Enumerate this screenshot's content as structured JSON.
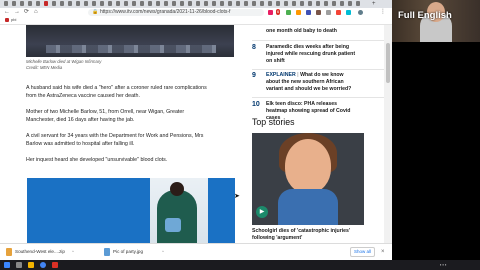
{
  "browser": {
    "url": "https://www.itv.com/news/granada/2021-11-26/blood-clots-f",
    "bookmark_label": "pbi",
    "badge": "6"
  },
  "article": {
    "caption_line1": "Michelle Barlow died at Wigan Infirmary",
    "caption_line2": "Credit: MEN Media",
    "paragraphs": [
      [
        "A husband said his wife died a \"hero\" after a coroner ruled rare complications",
        "from the AstraZeneca vaccine caused her death."
      ],
      [
        "Mother of two Michelle Barlow, 51, from Orrell, near Wigan, Greater",
        "Manchester, died 16 days after having the jab."
      ],
      [
        "A civil servant for 34 years with the Department for Work and Pensions, Mrs",
        "Barlow was admitted to hospital after falling ill."
      ],
      [
        "Her inquest heard she developed \"unsurvivable\" blood clots."
      ]
    ]
  },
  "most_read": [
    {
      "num": "",
      "tag": "",
      "line1": "one month old baby to death",
      "line2": ""
    },
    {
      "num": "8",
      "tag": "",
      "line1": "Paramedic dies weeks after being",
      "line2": "injured while rescuing drunk patient",
      "line3": "on shift"
    },
    {
      "num": "9",
      "tag": "Explainer",
      "line1": "What do we know",
      "line2": "about the new southern African",
      "line3": "variant and should we be worried?"
    },
    {
      "num": "10",
      "tag": "",
      "line1": "Elk teen disco: PHA releases",
      "line2": "heatmap showing spread of Covid",
      "line3": "cases"
    }
  ],
  "top_stories": {
    "heading": "Top stories",
    "headline_line1": "Schoolgirl dies of 'catastrophic injuries'",
    "headline_line2": "following 'argument'"
  },
  "downloads": {
    "items": [
      {
        "name": "Southend-West ele....zip",
        "type": "zip"
      },
      {
        "name": "Pic of party.jpg",
        "type": "jpg"
      }
    ],
    "show_all": "Show all"
  },
  "webcam": {
    "title": "Full English"
  },
  "colors": {
    "accent": "#00376e",
    "video_blue": "#1a71c4"
  }
}
